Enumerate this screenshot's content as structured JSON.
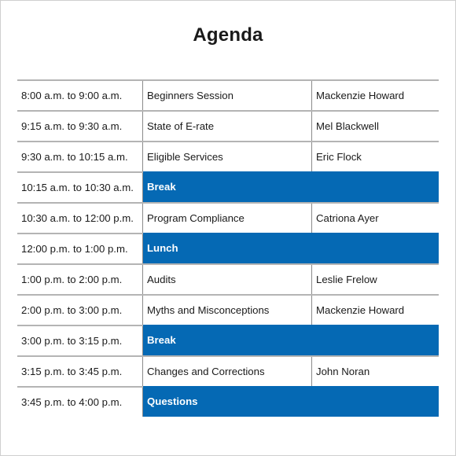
{
  "title": "Agenda",
  "colors": {
    "highlight": "#0569b4",
    "rule": "#b4b4b4",
    "divider": "#8a8a8a"
  },
  "rows": [
    {
      "time": "8:00 a.m. to 9:00 a.m.",
      "session": "Beginners Session",
      "speaker": "Mackenzie Howard",
      "highlight": false
    },
    {
      "time": "9:15 a.m. to 9:30 a.m.",
      "session": "State of E-rate",
      "speaker": "Mel Blackwell",
      "highlight": false
    },
    {
      "time": "9:30 a.m. to 10:15 a.m.",
      "session": "Eligible Services",
      "speaker": "Eric Flock",
      "highlight": false
    },
    {
      "time": "10:15 a.m. to 10:30 a.m.",
      "session": "Break",
      "speaker": "",
      "highlight": true
    },
    {
      "time": "10:30 a.m. to 12:00 p.m.",
      "session": "Program Compliance",
      "speaker": "Catriona Ayer",
      "highlight": false
    },
    {
      "time": "12:00 p.m. to 1:00 p.m.",
      "session": "Lunch",
      "speaker": "",
      "highlight": true
    },
    {
      "time": "1:00 p.m. to 2:00 p.m.",
      "session": "Audits",
      "speaker": "Leslie Frelow",
      "highlight": false
    },
    {
      "time": "2:00 p.m. to 3:00 p.m.",
      "session": "Myths and Misconceptions",
      "speaker": "Mackenzie Howard",
      "highlight": false
    },
    {
      "time": "3:00 p.m. to 3:15 p.m.",
      "session": "Break",
      "speaker": "",
      "highlight": true
    },
    {
      "time": "3:15 p.m. to 3:45 p.m.",
      "session": "Changes and Corrections",
      "speaker": "John Noran",
      "highlight": false
    },
    {
      "time": "3:45 p.m. to 4:00 p.m.",
      "session": "Questions",
      "speaker": "",
      "highlight": true
    }
  ]
}
